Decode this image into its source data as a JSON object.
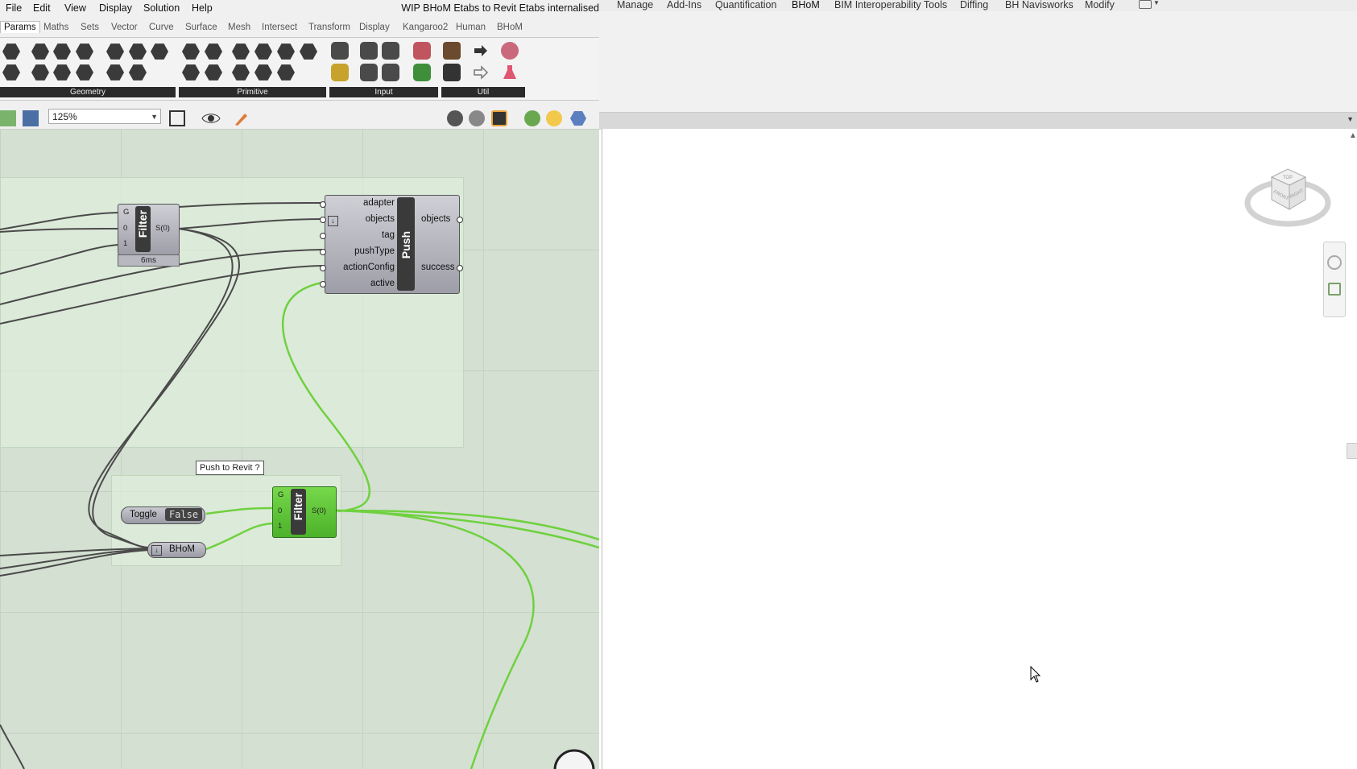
{
  "gh": {
    "menu": [
      "File",
      "Edit",
      "View",
      "Display",
      "Solution",
      "Help"
    ],
    "title": "WIP BHoM Etabs to Revit Etabs internalised",
    "tabs": [
      "Params",
      "Maths",
      "Sets",
      "Vector",
      "Curve",
      "Surface",
      "Mesh",
      "Intersect",
      "Transform",
      "Display",
      "Kangaroo2",
      "Human",
      "BHoM"
    ],
    "active_tab": "Params",
    "ribbon_groups": [
      "Geometry",
      "Primitive",
      "Input",
      "Util"
    ],
    "zoom": "125%"
  },
  "canvas": {
    "filter1": {
      "name": "Filter",
      "inputs": [
        "G",
        "0",
        "1"
      ],
      "output": "S(0)",
      "time": "6ms"
    },
    "push": {
      "name": "Push",
      "inputs": [
        "adapter",
        "objects",
        "tag",
        "pushType",
        "actionConfig",
        "active"
      ],
      "outputs": [
        "objects",
        "success"
      ]
    },
    "tooltip": "Push to Revit ?",
    "toggle": {
      "label": "Toggle",
      "value": "False"
    },
    "bhom_param": "BHoM",
    "filter2": {
      "name": "Filter",
      "inputs": [
        "G",
        "0",
        "1"
      ],
      "output": "S(0)"
    }
  },
  "revit": {
    "tabs": [
      "Manage",
      "Add-Ins",
      "Quantification",
      "BHoM",
      "BIM Interoperability Tools",
      "Diffing",
      "BH Navisworks",
      "Modify"
    ],
    "active_tab": "BHoM",
    "navcube": {
      "top": "TOP",
      "front": "FRONT",
      "right": "RIGHT"
    }
  },
  "colors": {
    "accent_green": "#6fd13f",
    "wire_dark": "#4a4a4a",
    "canvas_bg": "#d4e0d2"
  }
}
